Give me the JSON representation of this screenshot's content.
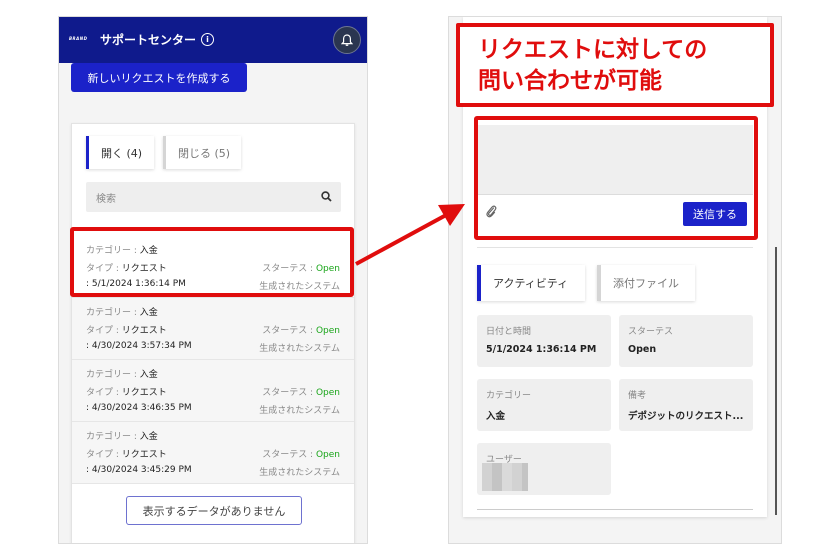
{
  "left": {
    "brand_logo": "BRAND",
    "title": "サポートセンター",
    "new_request_label": "新しいリクエストを作成する",
    "tabs": [
      {
        "label": "開く (4)"
      },
      {
        "label": "閉じる (5)"
      }
    ],
    "search_placeholder": "検索",
    "requests": [
      {
        "category_label": "カテゴリー : ",
        "category": "入金",
        "type_label": "タイプ : ",
        "type": "リクエスト",
        "date": ": 5/1/2024 1:36:14 PM",
        "status_label": "スターテス : ",
        "status": "Open",
        "created_by": "生成されたシステム"
      },
      {
        "category_label": "カテゴリー : ",
        "category": "入金",
        "type_label": "タイプ : ",
        "type": "リクエスト",
        "date": ": 4/30/2024 3:57:34 PM",
        "status_label": "スターテス : ",
        "status": "Open",
        "created_by": "生成されたシステム"
      },
      {
        "category_label": "カテゴリー : ",
        "category": "入金",
        "type_label": "タイプ : ",
        "type": "リクエスト",
        "date": ": 4/30/2024 3:46:35 PM",
        "status_label": "スターテス : ",
        "status": "Open",
        "created_by": "生成されたシステム"
      },
      {
        "category_label": "カテゴリー : ",
        "category": "入金",
        "type_label": "タイプ : ",
        "type": "リクエスト",
        "date": ": 4/30/2024 3:45:29 PM",
        "status_label": "スターテス : ",
        "status": "Open",
        "created_by": "生成されたシステム"
      }
    ],
    "no_data_label": "表示するデータがありません"
  },
  "callout": {
    "line1": "リクエストに対しての",
    "line2": "問い合わせが可能"
  },
  "right": {
    "send_label": "送信する",
    "tabs": [
      {
        "label": "アクティビティ"
      },
      {
        "label": "添付ファイル"
      }
    ],
    "details": {
      "datetime_label": "日付と時間",
      "datetime_value": "5/1/2024 1:36:14 PM",
      "status_label": "スターテス",
      "status_value": "Open",
      "category_label": "カテゴリー",
      "category_value": "入金",
      "note_label": "備考",
      "note_value": "デポジットのリクエスト...",
      "user_label": "ユーザー"
    }
  },
  "colors": {
    "header": "#0f1a8c",
    "primary_button": "#1b22c9",
    "highlight": "#e00d0d",
    "status_open": "#1aa51a"
  }
}
